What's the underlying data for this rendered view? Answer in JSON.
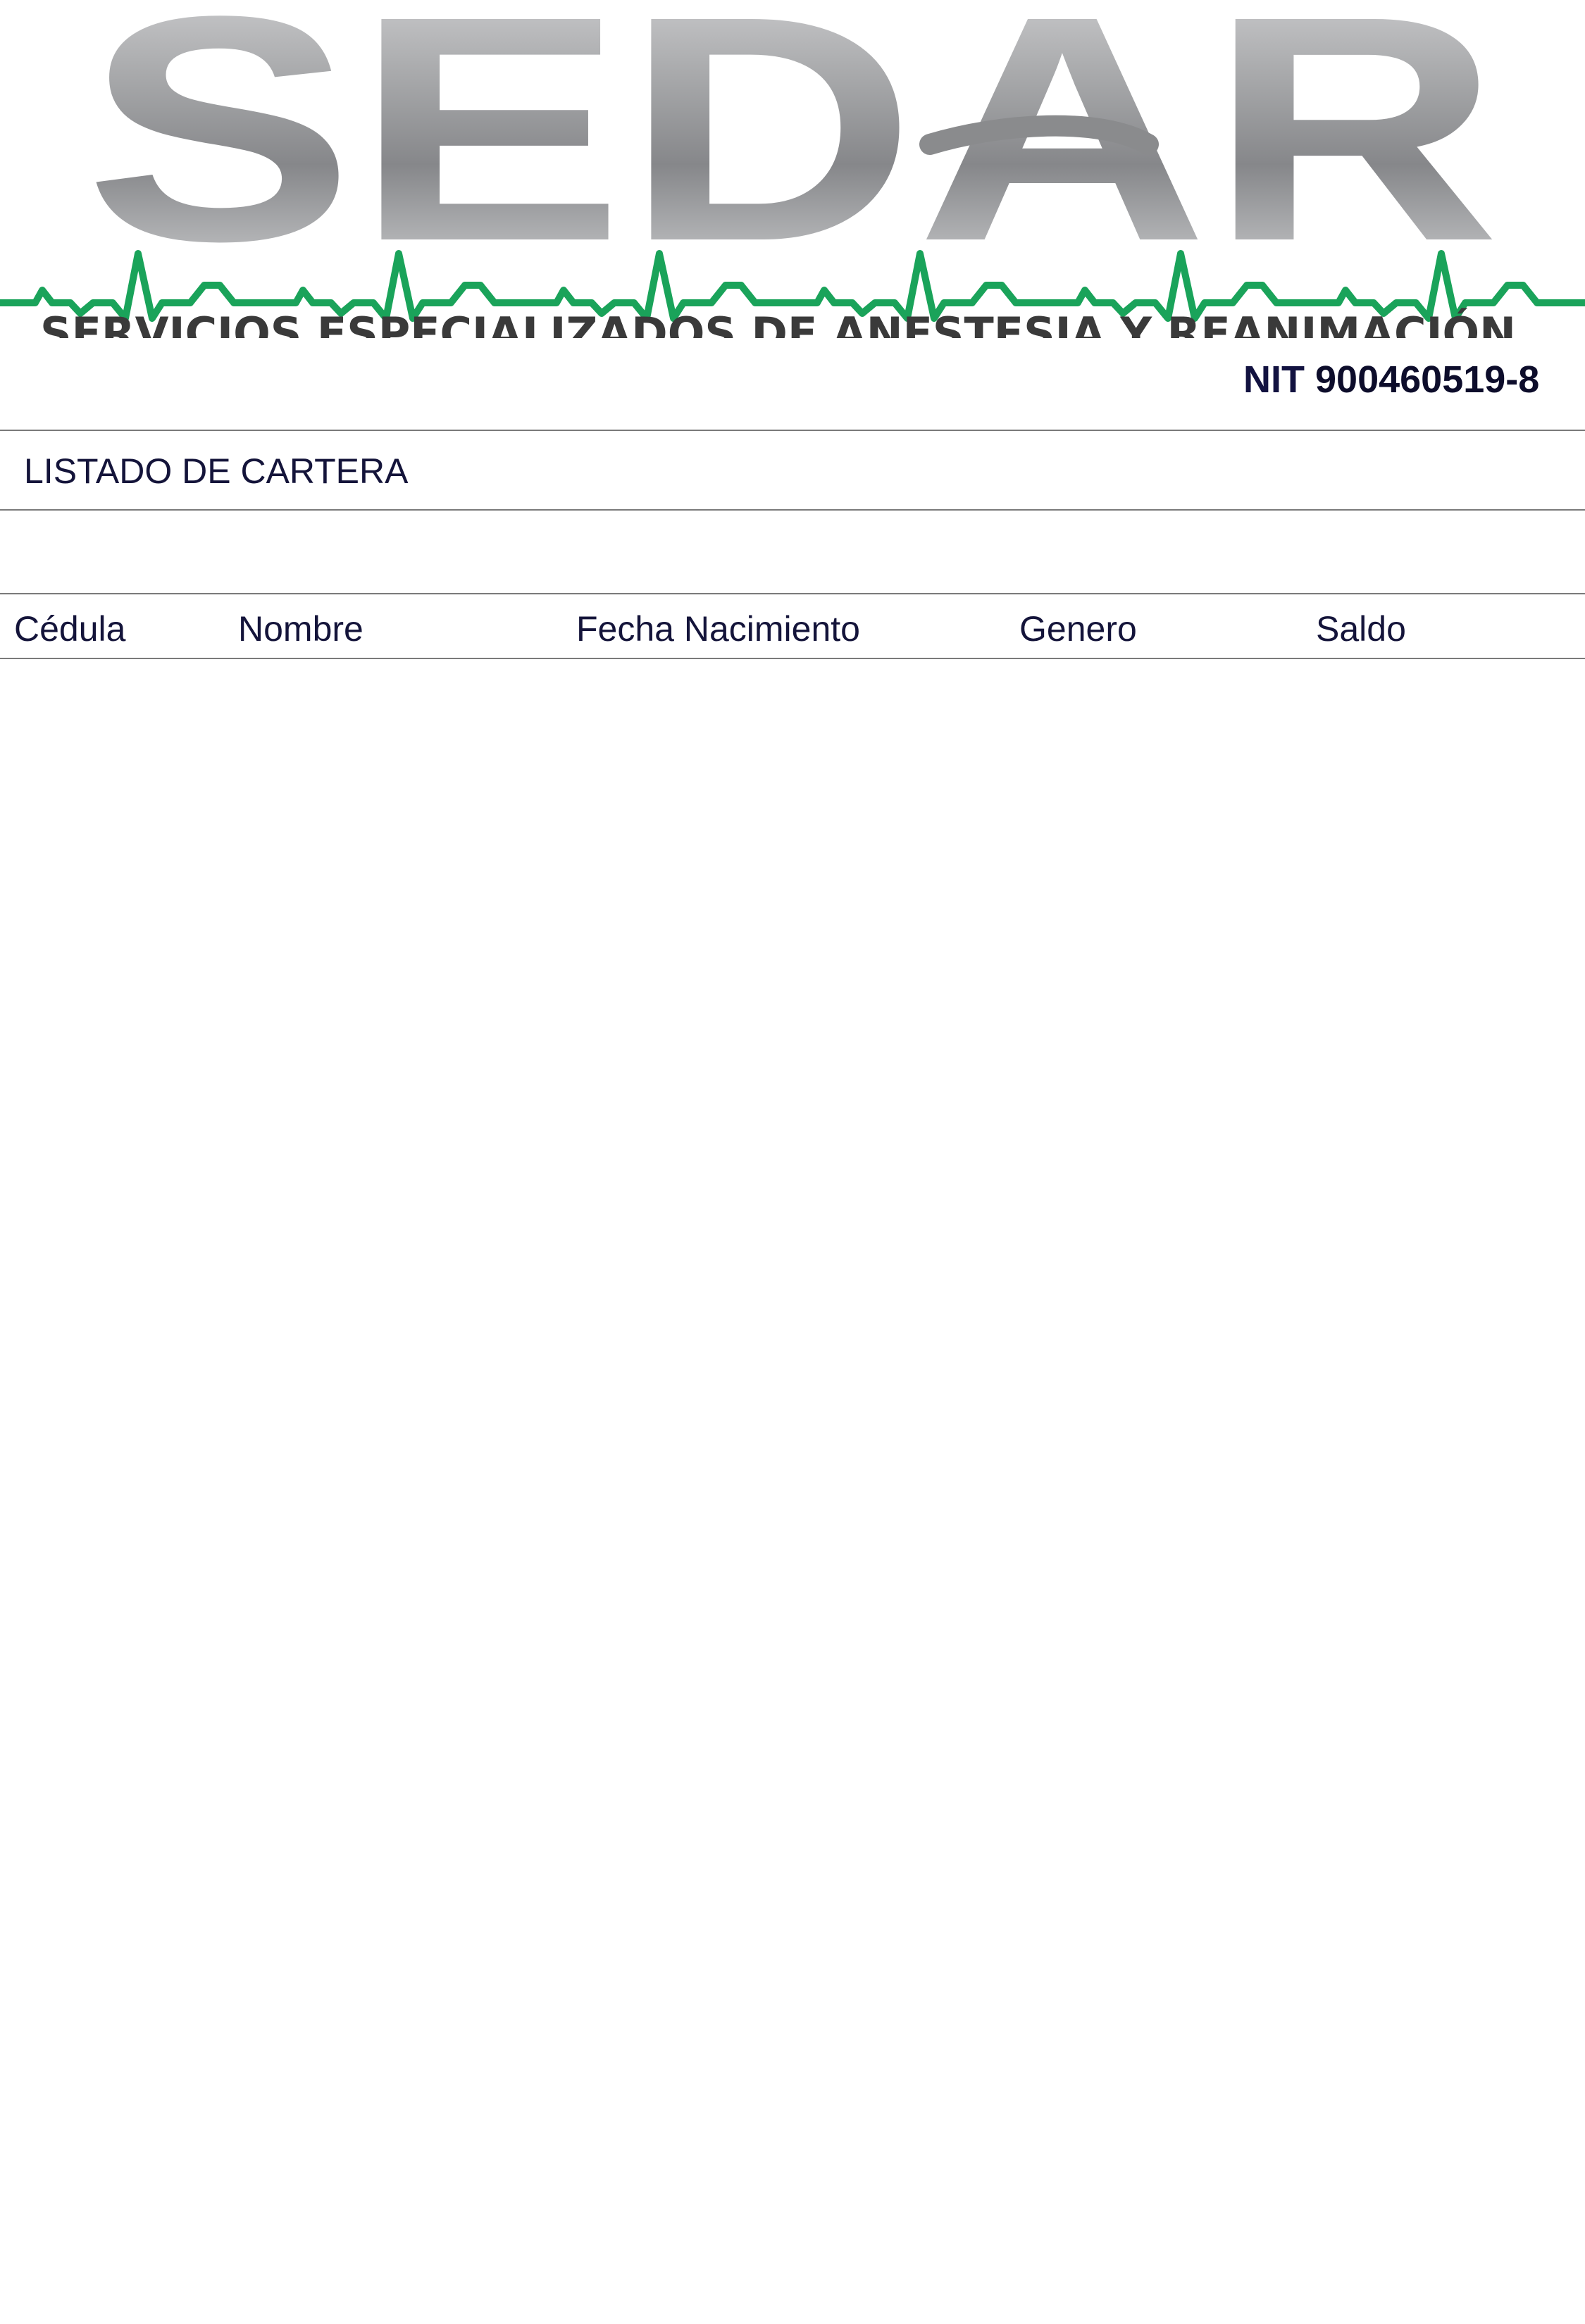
{
  "header": {
    "logo_text": "SEDAR",
    "tagline": "SERVICIOS ESPECIALIZADOS DE ANESTESIA Y REANIMACIÓN",
    "nit_label": "NIT",
    "nit_value": "900460519-8",
    "colors": {
      "logo_gray": "#8a8b8d",
      "heartbeat_green": "#1aa35a",
      "tagline_dark": "#3a3a3a",
      "text_navy": "#14143a"
    }
  },
  "report": {
    "title": "LISTADO DE CARTERA"
  },
  "table": {
    "columns": [
      "Cédula",
      "Nombre",
      "Fecha Nacimiento",
      "Genero",
      "Saldo"
    ],
    "rows": []
  }
}
